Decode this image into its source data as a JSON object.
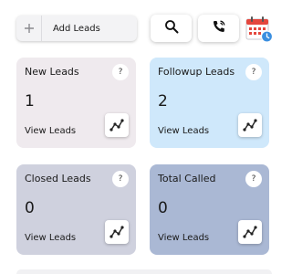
{
  "toolbar": {
    "add_leads_label": "Add Leads"
  },
  "cards": [
    {
      "title": "New Leads",
      "count": "1",
      "view_label": "View Leads",
      "help": "?"
    },
    {
      "title": "Followup Leads",
      "count": "2",
      "view_label": "View Leads",
      "help": "?"
    },
    {
      "title": "Closed Leads",
      "count": "0",
      "view_label": "View Leads",
      "help": "?"
    },
    {
      "title": "Total Called",
      "count": "0",
      "view_label": "View Leads",
      "help": "?"
    }
  ],
  "colors": {
    "new_leads_bg": "#efeaee",
    "followup_bg": "#cfe8fb",
    "closed_bg": "#cfd1de",
    "called_bg": "#aab8d4",
    "calendar_red": "#e4463d",
    "calendar_badge": "#3b8fe0"
  },
  "icons": {
    "add": "plus-icon",
    "search": "search-icon",
    "call": "phone-call-icon",
    "calendar": "calendar-icon",
    "help": "question-icon",
    "trend": "trend-chart-icon"
  }
}
